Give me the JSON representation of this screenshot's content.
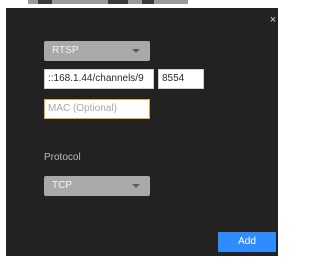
{
  "dialog": {
    "close_glyph": "×",
    "source_type_select": {
      "value": "RTSP"
    },
    "url_input": {
      "value": "::168.1.44/channels/9"
    },
    "port_input": {
      "value": "8554"
    },
    "mac_input": {
      "placeholder": "MAC (Optional)"
    },
    "protocol_label": "Protocol",
    "protocol_select": {
      "value": "TCP"
    },
    "add_button": "Add"
  },
  "colors": {
    "dialog_bg": "#222222",
    "accent": "#2e8cff",
    "focus_border": "#e8a64a"
  }
}
